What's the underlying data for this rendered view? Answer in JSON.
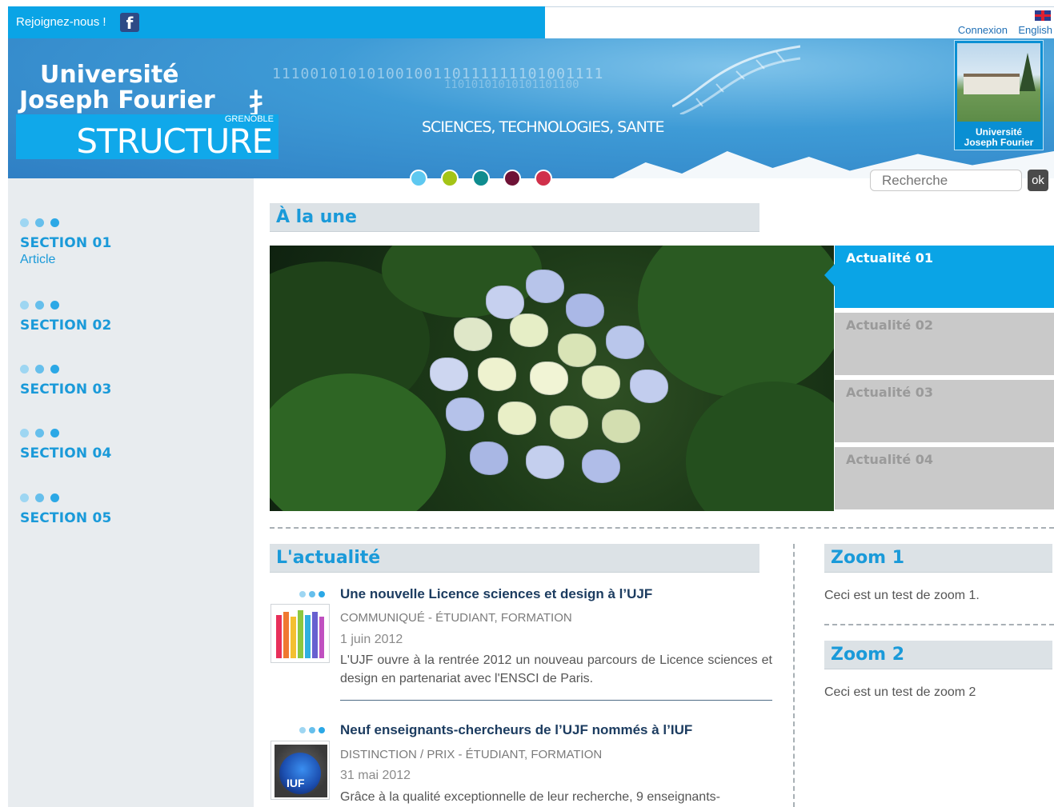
{
  "top": {
    "join_label": "Rejoignez-nous !",
    "facebook_glyph": "f",
    "connexion": "Connexion",
    "english": "English"
  },
  "banner": {
    "logo_line1": "Université",
    "logo_line2": "Joseph Fourier",
    "grenoble": "GRENOBLE",
    "structure": "STRUCTURE",
    "tagline": "SCIENCES, TECHNOLOGIES, SANTE",
    "binary_line1": "11100101010100100110111111101001111",
    "binary_line2": "11010101010101101100",
    "photo_caption1": "Université",
    "photo_caption2": "Joseph Fourier",
    "dot_colors": [
      "#5ec8f0",
      "#a4c416",
      "#0f8c8f",
      "#6e1236",
      "#d0304a"
    ]
  },
  "search": {
    "placeholder": "Recherche",
    "ok_label": "ok"
  },
  "sidebar": {
    "sections": [
      {
        "title": "SECTION 01",
        "sub": "Article"
      },
      {
        "title": "SECTION 02",
        "sub": ""
      },
      {
        "title": "SECTION 03",
        "sub": ""
      },
      {
        "title": "SECTION 04",
        "sub": ""
      },
      {
        "title": "SECTION 05",
        "sub": ""
      }
    ]
  },
  "main": {
    "a_la_une": "À la une",
    "news_tabs": [
      "Actualité 01",
      "Actualité 02",
      "Actualité 03",
      "Actualité 04"
    ],
    "actualite_heading": "L'actualité",
    "articles": [
      {
        "title": "Une nouvelle Licence sciences et design à l’UJF",
        "category": "COMMUNIQUÉ  -  ÉTUDIANT, FORMATION",
        "date": "1 juin 2012",
        "body": "L'UJF ouvre à la rentrée 2012 un nouveau parcours de Licence sciences et design en partenariat avec l'ENSCI de Paris."
      },
      {
        "title": "Neuf enseignants-chercheurs de l’UJF nommés à l’IUF",
        "category": "DISTINCTION / PRIX  -  ÉTUDIANT, FORMATION",
        "date": "31 mai 2012",
        "body": "Grâce à la qualité exceptionnelle de leur recherche, 9 enseignants-",
        "thumb_label": "IUF"
      }
    ],
    "zooms": [
      {
        "title": "Zoom 1",
        "text": "Ceci est un test de zoom 1."
      },
      {
        "title": "Zoom 2",
        "text": "Ceci est un test de zoom 2"
      }
    ]
  }
}
